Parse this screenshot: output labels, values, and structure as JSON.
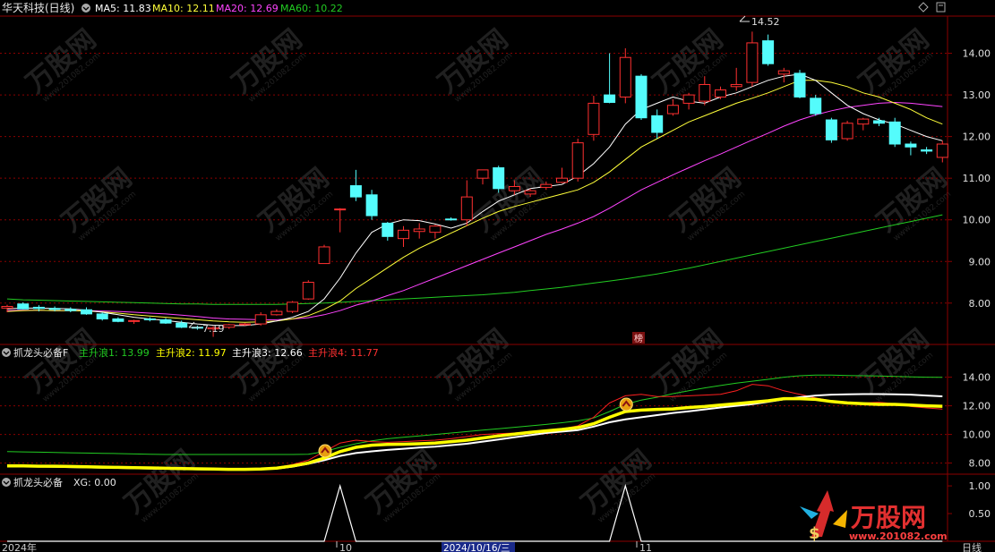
{
  "colors": {
    "bg": "#000000",
    "frame": "#8b0000",
    "grid": "#8b0000",
    "up": "#ff3030",
    "down": "#54fcfc",
    "ma5": "#ffffff",
    "ma10": "#ffff3a",
    "ma20": "#ff44ff",
    "ma60": "#22cc22",
    "wave1": "#22cc22",
    "wave2": "#ffff00",
    "wave3": "#ffffff",
    "wave4": "#ff2020"
  },
  "header": {
    "stock_name": "华天科技(日线)",
    "ma5": "MA5: 11.83",
    "ma10": "MA10: 12.11",
    "ma20": "MA20: 12.69",
    "ma60": "MA60: 10.22"
  },
  "panel2": {
    "title": "抓龙头必备F",
    "wave1": "主升浪1: 13.99",
    "wave2": "主升浪2: 11.97",
    "wave3": "主升浪3: 12.66",
    "wave4": "主升浪4: 11.77"
  },
  "panel3": {
    "title": "抓龙头必备",
    "xg": "XG: 0.00"
  },
  "annotations": {
    "high": "14.52",
    "low": "7.19",
    "badge": "榜"
  },
  "footer": {
    "year_label": "2024年",
    "month_oct": "10",
    "cursor_date": "2024/10/16/三",
    "month_nov": "11",
    "period": "日线"
  },
  "watermark": {
    "brand": "万股网",
    "url": "www.201082.com"
  },
  "chart_data": [
    {
      "type": "candlestick",
      "title": "华天科技(日线)",
      "y_ticks": [
        "14.00",
        "13.00",
        "12.00",
        "11.00",
        "10.00",
        "9.00",
        "8.00"
      ],
      "ylim": [
        7.05,
        14.85
      ],
      "candles": [
        {
          "o": 7.88,
          "h": 7.96,
          "l": 7.78,
          "c": 7.92
        },
        {
          "o": 7.98,
          "h": 8.02,
          "l": 7.85,
          "c": 7.86
        },
        {
          "o": 7.9,
          "h": 7.95,
          "l": 7.8,
          "c": 7.87
        },
        {
          "o": 7.87,
          "h": 7.92,
          "l": 7.8,
          "c": 7.85
        },
        {
          "o": 7.85,
          "h": 7.9,
          "l": 7.78,
          "c": 7.82
        },
        {
          "o": 7.84,
          "h": 7.9,
          "l": 7.72,
          "c": 7.74
        },
        {
          "o": 7.74,
          "h": 7.78,
          "l": 7.58,
          "c": 7.62
        },
        {
          "o": 7.62,
          "h": 7.66,
          "l": 7.54,
          "c": 7.56
        },
        {
          "o": 7.56,
          "h": 7.6,
          "l": 7.5,
          "c": 7.58
        },
        {
          "o": 7.62,
          "h": 7.66,
          "l": 7.56,
          "c": 7.6
        },
        {
          "o": 7.6,
          "h": 7.64,
          "l": 7.5,
          "c": 7.52
        },
        {
          "o": 7.52,
          "h": 7.58,
          "l": 7.4,
          "c": 7.42
        },
        {
          "o": 7.42,
          "h": 7.46,
          "l": 7.36,
          "c": 7.4
        },
        {
          "o": 7.38,
          "h": 7.44,
          "l": 7.19,
          "c": 7.41
        },
        {
          "o": 7.42,
          "h": 7.5,
          "l": 7.38,
          "c": 7.48
        },
        {
          "o": 7.48,
          "h": 7.52,
          "l": 7.46,
          "c": 7.5
        },
        {
          "o": 7.5,
          "h": 7.78,
          "l": 7.46,
          "c": 7.72
        },
        {
          "o": 7.72,
          "h": 7.85,
          "l": 7.7,
          "c": 7.8
        },
        {
          "o": 7.8,
          "h": 8.05,
          "l": 7.76,
          "c": 8.02
        },
        {
          "o": 8.1,
          "h": 8.55,
          "l": 8.08,
          "c": 8.5
        },
        {
          "o": 8.95,
          "h": 9.4,
          "l": 8.95,
          "c": 9.35
        },
        {
          "o": 10.25,
          "h": 10.28,
          "l": 9.7,
          "c": 10.26
        },
        {
          "o": 10.82,
          "h": 11.2,
          "l": 10.45,
          "c": 10.55
        },
        {
          "o": 10.6,
          "h": 10.72,
          "l": 10.0,
          "c": 10.1
        },
        {
          "o": 9.92,
          "h": 9.95,
          "l": 9.5,
          "c": 9.6
        },
        {
          "o": 9.55,
          "h": 9.85,
          "l": 9.35,
          "c": 9.75
        },
        {
          "o": 9.72,
          "h": 9.92,
          "l": 9.55,
          "c": 9.78
        },
        {
          "o": 9.7,
          "h": 9.88,
          "l": 9.55,
          "c": 9.85
        },
        {
          "o": 10.02,
          "h": 10.06,
          "l": 9.98,
          "c": 10.0
        },
        {
          "o": 10.0,
          "h": 10.95,
          "l": 9.85,
          "c": 10.55
        },
        {
          "o": 11.0,
          "h": 11.2,
          "l": 10.85,
          "c": 11.2
        },
        {
          "o": 11.25,
          "h": 11.3,
          "l": 10.65,
          "c": 10.75
        },
        {
          "o": 10.7,
          "h": 10.95,
          "l": 10.6,
          "c": 10.8
        },
        {
          "o": 10.62,
          "h": 10.75,
          "l": 10.55,
          "c": 10.7
        },
        {
          "o": 10.78,
          "h": 10.92,
          "l": 10.72,
          "c": 10.85
        },
        {
          "o": 10.9,
          "h": 11.25,
          "l": 10.88,
          "c": 11.0
        },
        {
          "o": 11.0,
          "h": 11.95,
          "l": 10.92,
          "c": 11.85
        },
        {
          "o": 12.05,
          "h": 12.98,
          "l": 11.9,
          "c": 12.8
        },
        {
          "o": 13.0,
          "h": 14.0,
          "l": 12.8,
          "c": 12.82
        },
        {
          "o": 12.95,
          "h": 14.12,
          "l": 12.8,
          "c": 13.9
        },
        {
          "o": 13.45,
          "h": 13.5,
          "l": 12.4,
          "c": 12.45
        },
        {
          "o": 12.5,
          "h": 12.65,
          "l": 11.95,
          "c": 12.1
        },
        {
          "o": 12.55,
          "h": 12.9,
          "l": 12.5,
          "c": 12.75
        },
        {
          "o": 12.8,
          "h": 13.05,
          "l": 12.65,
          "c": 13.0
        },
        {
          "o": 12.85,
          "h": 13.45,
          "l": 12.75,
          "c": 13.25
        },
        {
          "o": 12.95,
          "h": 13.2,
          "l": 12.9,
          "c": 13.12
        },
        {
          "o": 13.2,
          "h": 13.65,
          "l": 13.1,
          "c": 13.25
        },
        {
          "o": 13.3,
          "h": 14.52,
          "l": 13.2,
          "c": 14.25
        },
        {
          "o": 14.3,
          "h": 14.45,
          "l": 13.7,
          "c": 13.75
        },
        {
          "o": 13.5,
          "h": 13.65,
          "l": 13.3,
          "c": 13.58
        },
        {
          "o": 13.52,
          "h": 13.6,
          "l": 12.92,
          "c": 12.95
        },
        {
          "o": 12.92,
          "h": 13.0,
          "l": 12.5,
          "c": 12.55
        },
        {
          "o": 12.4,
          "h": 12.45,
          "l": 11.85,
          "c": 11.92
        },
        {
          "o": 11.95,
          "h": 12.38,
          "l": 11.9,
          "c": 12.32
        },
        {
          "o": 12.3,
          "h": 12.45,
          "l": 12.15,
          "c": 12.42
        },
        {
          "o": 12.38,
          "h": 12.45,
          "l": 12.25,
          "c": 12.32
        },
        {
          "o": 12.35,
          "h": 12.45,
          "l": 11.75,
          "c": 11.82
        },
        {
          "o": 11.82,
          "h": 11.88,
          "l": 11.55,
          "c": 11.75
        },
        {
          "o": 11.68,
          "h": 11.75,
          "l": 11.58,
          "c": 11.65
        },
        {
          "o": 11.5,
          "h": 11.9,
          "l": 11.38,
          "c": 11.82
        }
      ],
      "ma5": [
        7.86,
        7.88,
        7.88,
        7.87,
        7.86,
        7.83,
        7.78,
        7.72,
        7.66,
        7.62,
        7.58,
        7.54,
        7.5,
        7.47,
        7.46,
        7.46,
        7.5,
        7.57,
        7.66,
        7.8,
        8.1,
        8.6,
        9.2,
        9.7,
        9.9,
        10.0,
        9.98,
        9.9,
        9.8,
        9.92,
        10.2,
        10.45,
        10.6,
        10.75,
        10.8,
        10.85,
        11.05,
        11.35,
        11.75,
        12.3,
        12.65,
        12.8,
        12.95,
        12.85,
        12.8,
        12.95,
        13.05,
        13.2,
        13.35,
        13.45,
        13.5,
        13.35,
        13.05,
        12.75,
        12.55,
        12.4,
        12.3,
        12.15,
        12.0,
        11.9
      ],
      "ma10": [
        7.8,
        7.82,
        7.83,
        7.82,
        7.82,
        7.81,
        7.79,
        7.76,
        7.72,
        7.69,
        7.66,
        7.63,
        7.6,
        7.57,
        7.55,
        7.54,
        7.55,
        7.57,
        7.62,
        7.7,
        7.85,
        8.05,
        8.35,
        8.6,
        8.85,
        9.1,
        9.32,
        9.5,
        9.68,
        9.86,
        10.04,
        10.2,
        10.32,
        10.42,
        10.52,
        10.62,
        10.72,
        10.9,
        11.15,
        11.45,
        11.75,
        11.95,
        12.15,
        12.35,
        12.5,
        12.65,
        12.8,
        12.92,
        13.05,
        13.2,
        13.35,
        13.35,
        13.3,
        13.2,
        13.05,
        12.95,
        12.8,
        12.65,
        12.45,
        12.3
      ],
      "ma20": [
        7.82,
        7.83,
        7.83,
        7.82,
        7.82,
        7.82,
        7.81,
        7.8,
        7.78,
        7.76,
        7.74,
        7.71,
        7.68,
        7.64,
        7.62,
        7.61,
        7.6,
        7.6,
        7.62,
        7.65,
        7.72,
        7.82,
        7.95,
        8.05,
        8.18,
        8.3,
        8.45,
        8.6,
        8.75,
        8.9,
        9.05,
        9.2,
        9.35,
        9.5,
        9.65,
        9.78,
        9.92,
        10.08,
        10.28,
        10.5,
        10.72,
        10.9,
        11.08,
        11.25,
        11.42,
        11.58,
        11.75,
        11.92,
        12.08,
        12.25,
        12.4,
        12.52,
        12.62,
        12.7,
        12.75,
        12.8,
        12.82,
        12.8,
        12.76,
        12.72
      ],
      "ma60": [
        8.1,
        8.08,
        8.07,
        8.06,
        8.05,
        8.04,
        8.03,
        8.02,
        8.01,
        8.0,
        7.99,
        7.98,
        7.98,
        7.97,
        7.97,
        7.97,
        7.97,
        7.97,
        7.98,
        7.99,
        8.0,
        8.02,
        8.04,
        8.06,
        8.08,
        8.1,
        8.12,
        8.14,
        8.16,
        8.18,
        8.2,
        8.23,
        8.26,
        8.3,
        8.34,
        8.38,
        8.43,
        8.48,
        8.53,
        8.58,
        8.64,
        8.7,
        8.77,
        8.84,
        8.92,
        9.0,
        9.08,
        9.16,
        9.24,
        9.32,
        9.4,
        9.48,
        9.56,
        9.64,
        9.72,
        9.8,
        9.88,
        9.96,
        10.04,
        10.12
      ]
    },
    {
      "type": "line",
      "title": "抓龙头必备F",
      "y_ticks": [
        "14.00",
        "12.00",
        "10.00",
        "8.00"
      ],
      "ylim": [
        7.35,
        15.1
      ],
      "series": [
        {
          "name": "主升浪1",
          "values": [
            8.8,
            8.78,
            8.76,
            8.74,
            8.72,
            8.7,
            8.68,
            8.66,
            8.64,
            8.62,
            8.6,
            8.6,
            8.6,
            8.6,
            8.6,
            8.6,
            8.6,
            8.6,
            8.6,
            8.62,
            8.8,
            9.1,
            9.35,
            9.55,
            9.7,
            9.8,
            9.9,
            10.0,
            10.1,
            10.2,
            10.3,
            10.4,
            10.5,
            10.6,
            10.7,
            10.82,
            10.95,
            11.15,
            11.6,
            12.1,
            12.4,
            12.6,
            12.85,
            13.05,
            13.25,
            13.42,
            13.58,
            13.72,
            13.85,
            14.0,
            14.1,
            14.15,
            14.15,
            14.12,
            14.1,
            14.08,
            14.05,
            14.02,
            14.0,
            13.99
          ]
        },
        {
          "name": "主升浪2",
          "values": [
            7.8,
            7.8,
            7.78,
            7.78,
            7.76,
            7.74,
            7.72,
            7.7,
            7.68,
            7.66,
            7.64,
            7.62,
            7.6,
            7.58,
            7.56,
            7.56,
            7.58,
            7.65,
            7.8,
            8.0,
            8.35,
            8.8,
            9.1,
            9.25,
            9.3,
            9.32,
            9.35,
            9.4,
            9.5,
            9.6,
            9.75,
            9.9,
            10.02,
            10.15,
            10.25,
            10.35,
            10.48,
            10.75,
            11.2,
            11.6,
            11.7,
            11.75,
            11.78,
            11.88,
            11.95,
            12.05,
            12.15,
            12.25,
            12.35,
            12.5,
            12.5,
            12.45,
            12.3,
            12.2,
            12.15,
            12.1,
            12.1,
            12.05,
            12.0,
            11.97
          ]
        },
        {
          "name": "主升浪3",
          "values": [
            7.8,
            7.78,
            7.76,
            7.74,
            7.72,
            7.7,
            7.68,
            7.66,
            7.64,
            7.62,
            7.6,
            7.58,
            7.56,
            7.55,
            7.55,
            7.56,
            7.58,
            7.62,
            7.75,
            7.95,
            8.2,
            8.5,
            8.7,
            8.82,
            8.92,
            9.0,
            9.08,
            9.15,
            9.25,
            9.35,
            9.5,
            9.65,
            9.8,
            9.95,
            10.1,
            10.2,
            10.3,
            10.55,
            10.85,
            11.05,
            11.2,
            11.35,
            11.5,
            11.62,
            11.75,
            11.88,
            12.0,
            12.12,
            12.28,
            12.45,
            12.6,
            12.72,
            12.78,
            12.8,
            12.82,
            12.82,
            12.8,
            12.78,
            12.72,
            12.66
          ]
        },
        {
          "name": "主升浪4",
          "values": [
            7.8,
            7.8,
            7.78,
            7.78,
            7.76,
            7.74,
            7.72,
            7.7,
            7.68,
            7.66,
            7.64,
            7.62,
            7.6,
            7.58,
            7.56,
            7.56,
            7.6,
            7.7,
            7.9,
            8.2,
            8.8,
            9.4,
            9.6,
            9.5,
            9.45,
            9.5,
            9.55,
            9.6,
            9.7,
            9.85,
            10.0,
            10.05,
            10.1,
            10.2,
            10.3,
            10.4,
            10.6,
            11.2,
            12.2,
            12.7,
            12.8,
            12.65,
            12.65,
            12.7,
            12.75,
            12.8,
            13.05,
            13.5,
            13.4,
            13.05,
            12.8,
            12.55,
            12.35,
            12.25,
            12.2,
            12.25,
            12.15,
            11.95,
            11.85,
            11.77
          ]
        }
      ]
    },
    {
      "type": "line",
      "title": "抓龙头必备",
      "y_ticks": [
        "1.00",
        "0.50"
      ],
      "ylim": [
        0,
        1.05
      ],
      "series": [
        {
          "name": "XG",
          "values": [
            0,
            0,
            0,
            0,
            0,
            0,
            0,
            0,
            0,
            0,
            0,
            0,
            0,
            0,
            0,
            0,
            0,
            0,
            0,
            0,
            0,
            1,
            0,
            0,
            0,
            0,
            0,
            0,
            0,
            0,
            0,
            0,
            0,
            0,
            0,
            0,
            0,
            0,
            0,
            1,
            0,
            0,
            0,
            0,
            0,
            0,
            0,
            0,
            0,
            0,
            0,
            0,
            0,
            0,
            0,
            0,
            0,
            0,
            0,
            0
          ]
        }
      ],
      "signal_index": [
        20,
        39
      ]
    }
  ]
}
